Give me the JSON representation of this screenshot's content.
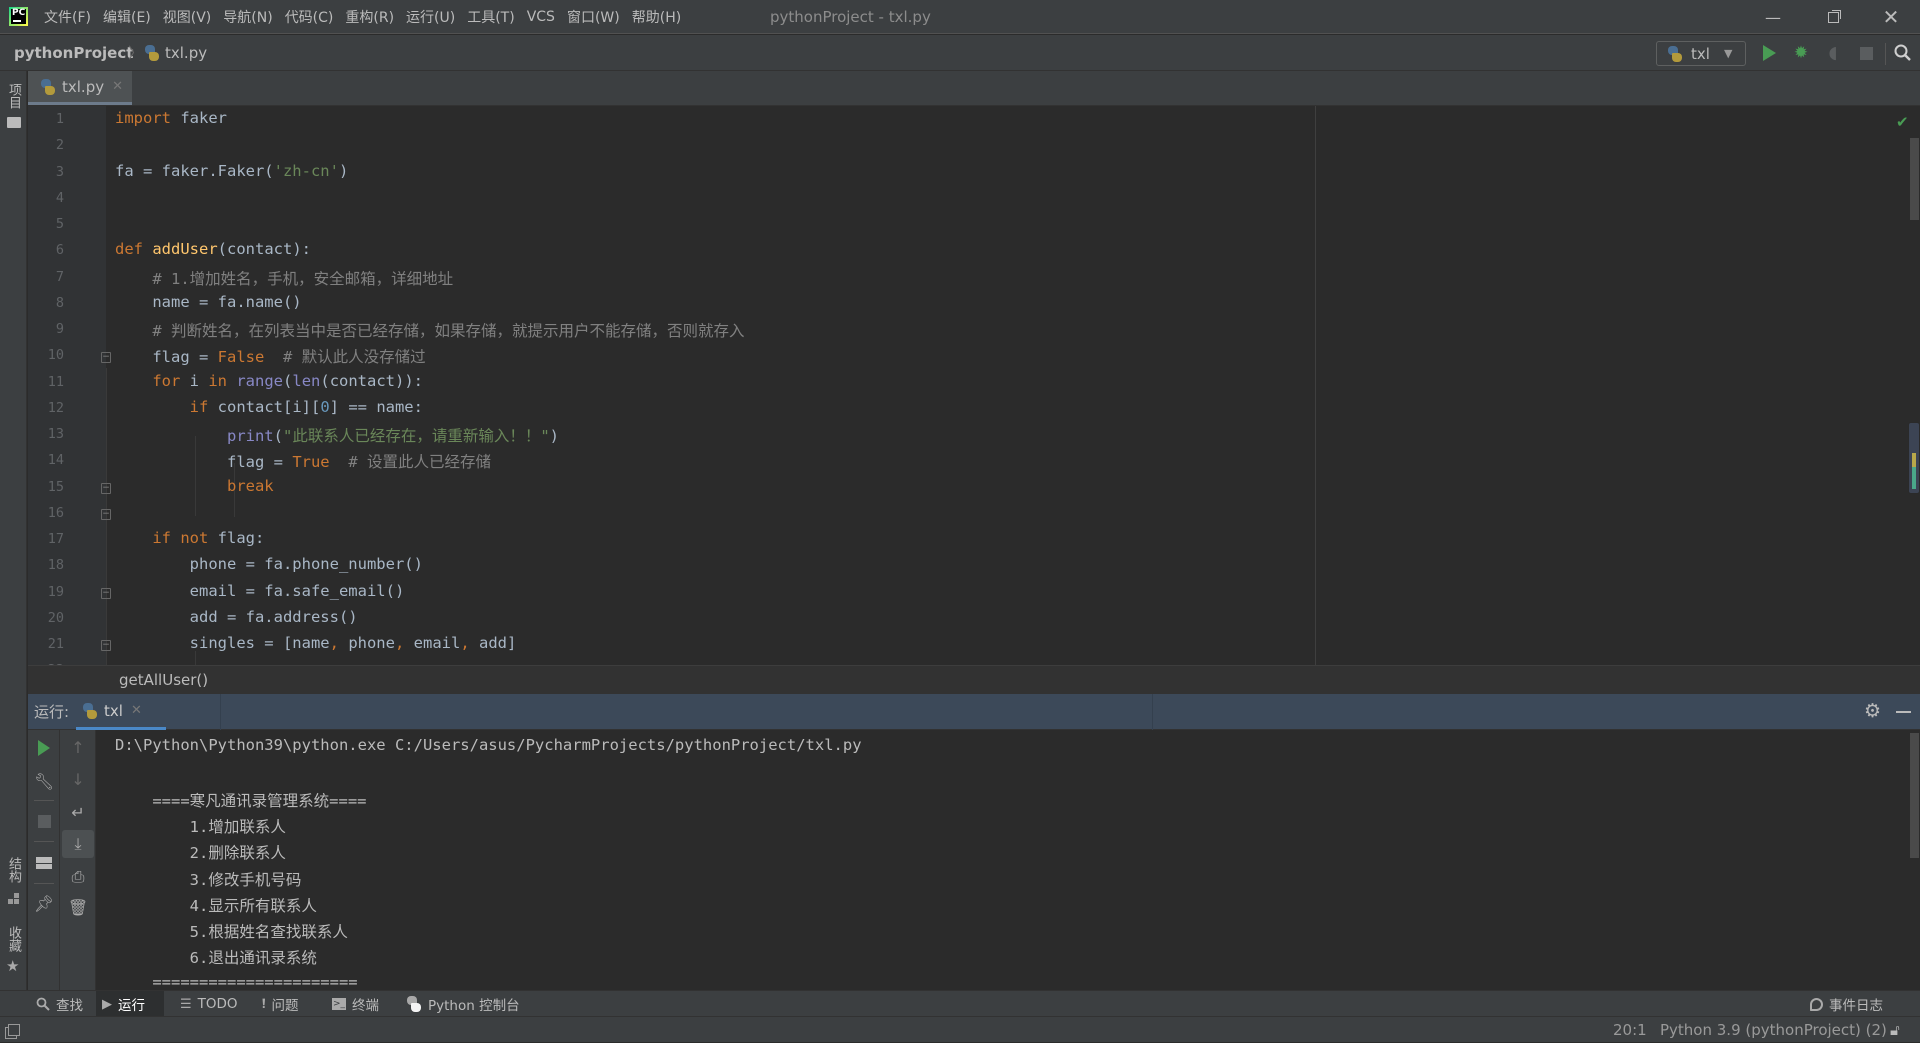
{
  "window": {
    "title": "pythonProject - txl.py",
    "controls": [
      "minimize",
      "restore",
      "close"
    ]
  },
  "menu": [
    "文件(F)",
    "编辑(E)",
    "视图(V)",
    "导航(N)",
    "代码(C)",
    "重构(R)",
    "运行(U)",
    "工具(T)",
    "VCS",
    "窗口(W)",
    "帮助(H)"
  ],
  "navbar": {
    "project": "pythonProject",
    "file": "txl.py",
    "run_config": "txl"
  },
  "left_strip": {
    "project_label": "项目",
    "structure_label": "结构",
    "favorites_label": "收藏"
  },
  "tab": {
    "label": "txl.py"
  },
  "editor": {
    "lines": [
      {
        "n": "1",
        "html": "<span class=\"kw\">import</span> faker"
      },
      {
        "n": "2",
        "html": ""
      },
      {
        "n": "3",
        "html": "fa = faker.Faker(<span class=\"str\">'zh-cn'</span>)"
      },
      {
        "n": "4",
        "html": ""
      },
      {
        "n": "5",
        "html": ""
      },
      {
        "n": "6",
        "html": "<span class=\"kw\">def</span> <span class=\"fn\">addUser</span>(contact):"
      },
      {
        "n": "7",
        "html": "    <span class=\"cm\"># 1.增加姓名，手机，安全邮箱，详细地址</span>"
      },
      {
        "n": "8",
        "html": "    name = fa.name()"
      },
      {
        "n": "9",
        "html": "    <span class=\"cm\"># 判断姓名，在列表当中是否已经存储，如果存储，就提示用户不能存储，否则就存入</span>"
      },
      {
        "n": "10",
        "html": "    flag = <span class=\"kw\">False</span>  <span class=\"cm\"># 默认此人没存储过</span>"
      },
      {
        "n": "11",
        "html": "    <span class=\"kw\">for</span> i <span class=\"kw\">in</span> <span class=\"bi\">range</span>(<span class=\"bi\">len</span>(contact)):"
      },
      {
        "n": "12",
        "html": "        <span class=\"kw\">if</span> contact[i][<span class=\"num\">0</span>] == name:"
      },
      {
        "n": "13",
        "html": "            <span class=\"bi\">print</span>(<span class=\"str\">\"此联系人已经存在，请重新输入！！\"</span>)"
      },
      {
        "n": "14",
        "html": "            flag = <span class=\"kw\">True</span>  <span class=\"cm\"># 设置此人已经存储</span>"
      },
      {
        "n": "15",
        "html": "            <span class=\"kw\">break</span>"
      },
      {
        "n": "16",
        "html": ""
      },
      {
        "n": "17",
        "html": "    <span class=\"kw\">if not</span> flag:"
      },
      {
        "n": "18",
        "html": "        phone = fa.phone_number()"
      },
      {
        "n": "19",
        "html": "        email = fa.safe_email()"
      },
      {
        "n": "20",
        "html": "        add = fa.address()"
      },
      {
        "n": "21",
        "html": "        singles = [name<span class=\"kw\">,</span> phone<span class=\"kw\">,</span> email<span class=\"kw\">,</span> add]"
      }
    ],
    "breadcrumb": "getAllUser()"
  },
  "run_panel": {
    "label": "运行:",
    "tab": "txl",
    "output": [
      "D:\\Python\\Python39\\python.exe C:/Users/asus/PycharmProjects/pythonProject/txl.py",
      "",
      "    ====寒凡通讯录管理系统====",
      "        1.增加联系人",
      "        2.删除联系人",
      "        3.修改手机号码",
      "        4.显示所有联系人",
      "        5.根据姓名查找联系人",
      "        6.退出通讯录系统",
      "    ======================"
    ]
  },
  "tool_tabs": [
    {
      "icon": "search-icon",
      "label": "查找"
    },
    {
      "icon": "run-icon",
      "label": "运行"
    },
    {
      "icon": "todo-icon",
      "label": "TODO"
    },
    {
      "icon": "problems-icon",
      "label": "问题"
    },
    {
      "icon": "terminal-icon",
      "label": "终端"
    },
    {
      "icon": "python-console-icon",
      "label": "Python 控制台"
    }
  ],
  "event_log": "事件日志",
  "status": {
    "position": "20:1",
    "interpreter": "Python 3.9 (pythonProject) (2)"
  },
  "colors": {
    "keyword": "#cc7832",
    "function": "#ffc66d",
    "string": "#6a8759",
    "comment": "#808080",
    "builtin": "#8888c6",
    "number": "#6897bb",
    "run_green": "#499c54",
    "accent_blue": "#4a88c7"
  }
}
